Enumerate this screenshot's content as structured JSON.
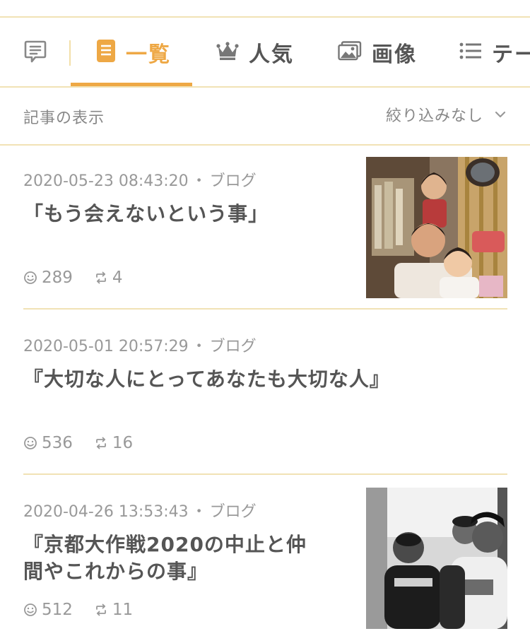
{
  "tabs": [
    {
      "label": "一覧",
      "icon": "list-doc-icon",
      "active": true
    },
    {
      "label": "人気",
      "icon": "crown-icon",
      "active": false
    },
    {
      "label": "画像",
      "icon": "image-icon",
      "active": false
    },
    {
      "label": "テー",
      "icon": "menu-lines-icon",
      "active": false
    }
  ],
  "filter": {
    "label": "記事の表示",
    "select_value": "絞り込みなし"
  },
  "entries": [
    {
      "datetime": "2020-05-23 08:43:20",
      "category": "ブログ",
      "title": "「もう会えないという事」",
      "likes": "289",
      "reblogs": "4",
      "has_thumb": true
    },
    {
      "datetime": "2020-05-01 20:57:29",
      "category": "ブログ",
      "title": "『大切な人にとってあなたも大切な人』",
      "likes": "536",
      "reblogs": "16",
      "has_thumb": false
    },
    {
      "datetime": "2020-04-26 13:53:43",
      "category": "ブログ",
      "title_line1": "『京都大作戦2020の中止と仲",
      "title_line2": "間やこれからの事』",
      "likes": "512",
      "reblogs": "11",
      "has_thumb": true
    }
  ],
  "colors": {
    "accent": "#eea845",
    "divider": "#f1e2b5",
    "text": "#555555",
    "muted": "#999999"
  }
}
